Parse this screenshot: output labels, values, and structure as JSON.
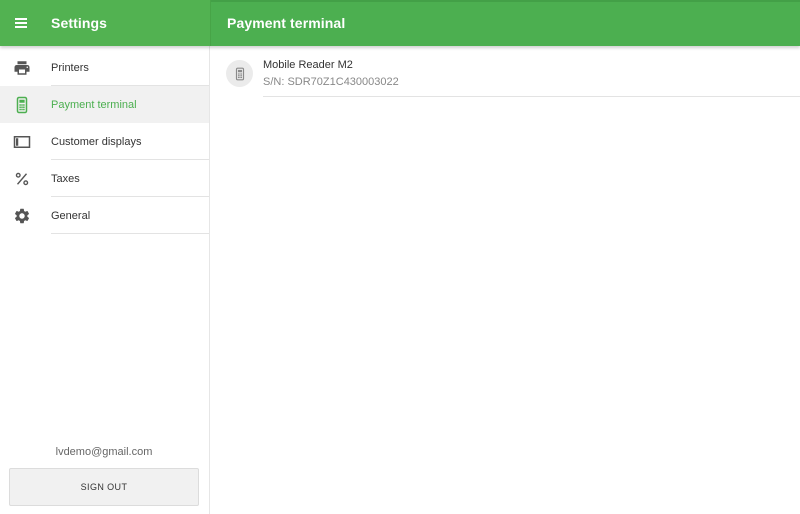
{
  "colors": {
    "accent": "#4caf50",
    "active_bg": "#f1f1f1",
    "icon_gray": "#555555"
  },
  "header": {
    "left_title": "Settings",
    "right_title": "Payment terminal",
    "menu_icon": "hamburger-menu-icon"
  },
  "sidebar": {
    "items": [
      {
        "label": "Printers",
        "icon": "printer-icon",
        "active": false
      },
      {
        "label": "Payment terminal",
        "icon": "card-terminal-icon",
        "active": true
      },
      {
        "label": "Customer displays",
        "icon": "display-icon",
        "active": false
      },
      {
        "label": "Taxes",
        "icon": "percent-icon",
        "active": false
      },
      {
        "label": "General",
        "icon": "gear-icon",
        "active": false
      }
    ],
    "account_email": "lvdemo@gmail.com",
    "sign_out_label": "SIGN OUT"
  },
  "main": {
    "devices": [
      {
        "name": "Mobile Reader M2",
        "serial": "S/N: SDR70Z1C430003022",
        "icon": "card-terminal-icon"
      }
    ]
  }
}
